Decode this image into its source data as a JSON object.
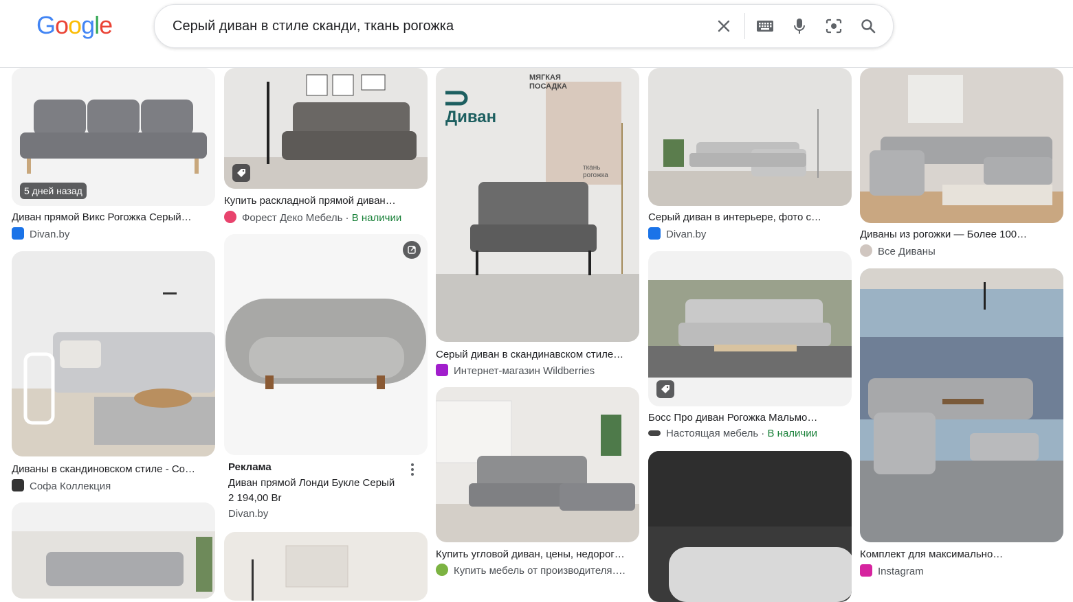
{
  "search": {
    "query": "Серый диван в стиле сканди, ткань рогожка",
    "logo": [
      "G",
      "o",
      "o",
      "g",
      "l",
      "e"
    ],
    "logo_colors": [
      "#4285F4",
      "#EA4335",
      "#FBBC05",
      "#4285F4",
      "#34A853",
      "#EA4335"
    ]
  },
  "results": [
    {
      "title": "Диван прямой Викс Рогожка Серый…",
      "source": "Divan.by",
      "badge": "5 дней назад"
    },
    {
      "title": "Купить раскладной прямой диван…",
      "source": "Форест Деко Мебель",
      "stock": "В наличии"
    },
    {
      "title": "Серый диван в скандинавском стиле…",
      "source": "Интернет-магазин Wildberries",
      "overlay_brand": "Диван",
      "overlay_text": "МЯГКАЯ ПОСАДКА",
      "overlay_note": "ткань рогожка"
    },
    {
      "title": "Серый диван в интерьере, фото с…",
      "source": "Divan.by"
    },
    {
      "title": "Диваны из рогожки — Более 100…",
      "source": "Все Диваны"
    },
    {
      "title": "Диваны в скандиновском стиле - Со…",
      "source": "Софа Коллекция"
    },
    {
      "title": "Босс Про диван Рогожка Мальмо…",
      "source": "Настоящая мебель",
      "stock": "В наличии"
    },
    {
      "title": "Купить угловой диван, цены, недорог…",
      "source": "Купить мебель от производителя…."
    },
    {
      "title": "Комплект для максимально…",
      "source": "Instagram"
    }
  ],
  "ad": {
    "label": "Реклама",
    "title": "Диван прямой Лонди Букле Серый",
    "price": "2 194,00 Br",
    "source": "Divan.by"
  },
  "colors": {
    "instock": "#188038",
    "text": "#202124",
    "muted": "#4d5156"
  }
}
